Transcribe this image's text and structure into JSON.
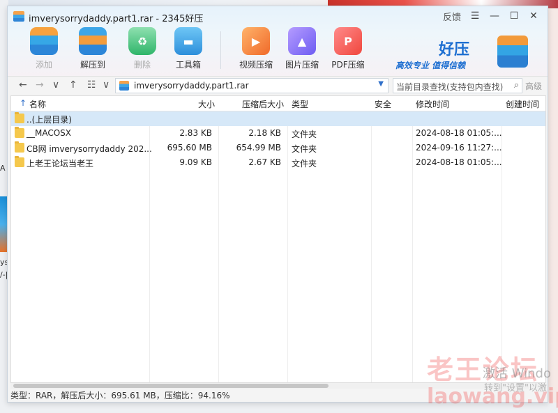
{
  "window": {
    "title": "imverysorrydaddy.part1.rar - 2345好压",
    "feedback": "反馈",
    "menu_glyph": "☰",
    "min_glyph": "—",
    "max_glyph": "☐",
    "close_glyph": "✕"
  },
  "toolbar": {
    "add": "添加",
    "extract": "解压到",
    "delete": "删除",
    "tools": "工具箱",
    "video": "视频压缩",
    "image": "图片压缩",
    "pdf": "PDF压缩"
  },
  "brand": {
    "logo": "好压",
    "slogan": "高效专业 值得信赖"
  },
  "nav": {
    "back": "←",
    "forward": "→",
    "down": "∨",
    "up": "↑",
    "view": "☷",
    "view_drop": "∨",
    "address": "imverysorrydaddy.part1.rar",
    "address_drop": "▼",
    "search_placeholder": "当前目录查找(支持包内查找)",
    "search_icon": "⌕",
    "advanced": "高级"
  },
  "columns": {
    "sort_arrow": "↑",
    "name": "名称",
    "size": "大小",
    "packed": "压缩后大小",
    "type": "类型",
    "security": "安全",
    "modified": "修改时间",
    "created": "创建时间"
  },
  "rows": [
    {
      "name": "..(上层目录)",
      "size": "",
      "packed": "",
      "type": "",
      "modified": ""
    },
    {
      "name": "__MACOSX",
      "size": "2.83 KB",
      "packed": "2.18 KB",
      "type": "文件夹",
      "modified": "2024-08-18 01:05:..."
    },
    {
      "name": "CB网 imverysorrydaddy 202...",
      "size": "695.60 MB",
      "packed": "654.99 MB",
      "type": "文件夹",
      "modified": "2024-09-16 11:27:..."
    },
    {
      "name": "上老王论坛当老王",
      "size": "9.09 KB",
      "packed": "2.67 KB",
      "type": "文件夹",
      "modified": "2024-08-18 01:05:..."
    }
  ],
  "status": "类型：RAR，解压后大小：695.61 MB，压缩比：94.16%",
  "watermark": {
    "cn": "老王论坛",
    "url": "laowang.vip",
    "activate": "激活 Windo",
    "activate_sub": "转到\"设置\"以激"
  },
  "desktop": {
    "left_a": "A",
    "left_y": "ys",
    "left_v": "/-|"
  }
}
